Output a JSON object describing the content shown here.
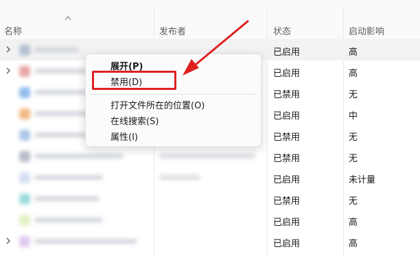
{
  "columns": {
    "name": "名称",
    "publisher": "发布者",
    "status": "状态",
    "impact": "启动影响"
  },
  "rows": [
    {
      "status": "已启用",
      "impact": "高",
      "expandable": true,
      "icon_color": "#9fb0c8"
    },
    {
      "status": "已启用",
      "impact": "高",
      "expandable": true,
      "icon_color": "#e38a8a"
    },
    {
      "status": "已禁用",
      "impact": "无",
      "expandable": false,
      "icon_color": "#6fa8e8"
    },
    {
      "status": "已启用",
      "impact": "中",
      "expandable": false,
      "icon_color": "#f0a35a"
    },
    {
      "status": "已禁用",
      "impact": "无",
      "expandable": false,
      "icon_color": "#8fb6e0"
    },
    {
      "status": "已禁用",
      "impact": "无",
      "expandable": false,
      "icon_color": "#a3a6b8"
    },
    {
      "status": "已启用",
      "impact": "未计量",
      "expandable": false,
      "icon_color": "#c9d3f0"
    },
    {
      "status": "已禁用",
      "impact": "无",
      "expandable": false,
      "icon_color": "#7fd0d0"
    },
    {
      "status": "已启用",
      "impact": "高",
      "expandable": false,
      "icon_color": "#d8ecb0"
    },
    {
      "status": "已启用",
      "impact": "高",
      "expandable": true,
      "icon_color": "#d4b8ec"
    }
  ],
  "context_menu": {
    "expand": "展开(P)",
    "disable": "禁用(D)",
    "open_location": "打开文件所在的位置(O)",
    "search_online": "在线搜索(S)",
    "properties": "属性(I)"
  },
  "annotation_color": "#e02020"
}
